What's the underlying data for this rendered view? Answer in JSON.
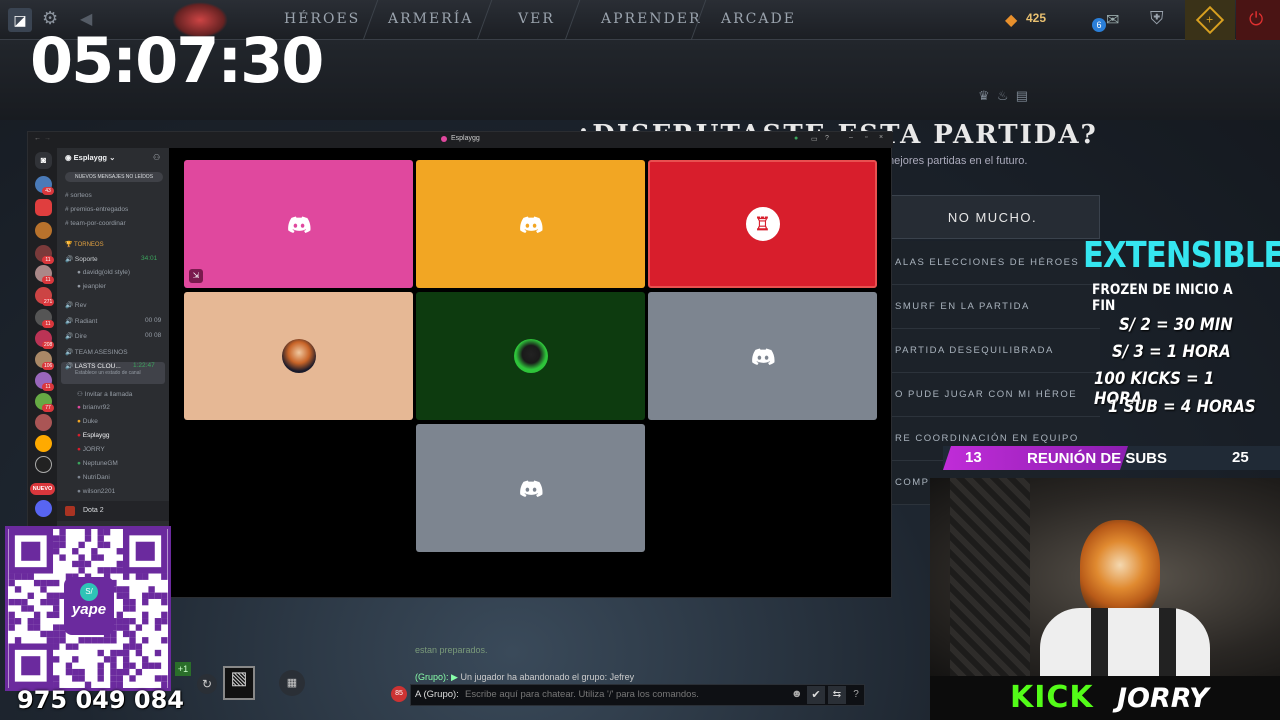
{
  "timer": "05:07:30",
  "topbar": {
    "nav": [
      "HÉROES",
      "ARMERÍA",
      "VER",
      "APRENDER",
      "ARCADE"
    ],
    "currency": "425",
    "notif_count": "6"
  },
  "survey": {
    "title": "¿DISFRUTASTE ESTA PARTIDA?",
    "subtitle": "mejores partidas en el futuro.",
    "options": [
      "NO MUCHO.",
      "ALAS ELECCIONES DE HÉROES",
      "SMURF EN LA PARTIDA",
      "PARTIDA DESEQUILIBRADA",
      "O PUDE JUGAR CON MI HÉROE",
      "RE COORDINACIÓN EN EQUIPO",
      "COMPO"
    ]
  },
  "discord": {
    "window_title": "Esplaygg",
    "server_name": "Esplaygg",
    "new_messages": "NUEVOS MENSAJES NO LEÍDOS",
    "channels": [
      "sorteos",
      "premios-entregados",
      "team-por-coordinar"
    ],
    "category_torneos": "TORNEOS",
    "voice": [
      {
        "name": "Soporte",
        "count": "34:01"
      },
      {
        "name": "davidg(old style)"
      },
      {
        "name": "jeanpler"
      },
      {
        "name": "Rev"
      },
      {
        "name": "Radiant",
        "count": "00 09"
      },
      {
        "name": "Dire",
        "count": "00 08"
      },
      {
        "name": "TEAM ASESINOS"
      },
      {
        "name": "LASTS CLOU...",
        "count": "1:22:47"
      },
      {
        "name": "Establece un estado de canal"
      },
      {
        "name": "Invitar a llamada"
      },
      {
        "name": "brianvr92"
      },
      {
        "name": "Duke"
      },
      {
        "name": "Esplaygg"
      },
      {
        "name": "JORRY"
      },
      {
        "name": "NeptuneGM"
      },
      {
        "name": "NutriDani"
      },
      {
        "name": "wilson2201"
      }
    ],
    "server_badges": [
      "43",
      "11",
      "11",
      "271",
      "11",
      "208",
      "106",
      "11",
      "77"
    ],
    "new_label": "NUEVO",
    "footer": "Dota 2",
    "tiles": [
      {
        "color": "#e0489e",
        "kind": "logo"
      },
      {
        "color": "#f2a623",
        "kind": "logo"
      },
      {
        "color": "#d81e2c",
        "kind": "avatar-red"
      },
      {
        "color": "#e6b895",
        "kind": "avatar-anime"
      },
      {
        "color": "#0d3b0f",
        "kind": "avatar-green"
      },
      {
        "color": "#7d8590",
        "kind": "logo"
      },
      {
        "color": "#7d8590",
        "kind": "logo"
      }
    ]
  },
  "promo": {
    "headline": "EXTENSIBLE",
    "sub": "FROZEN DE INICIO A FIN",
    "lines": [
      "S/ 2 = 30 MIN",
      "S/ 3  = 1 HORA",
      "100 KICKS = 1 HORA",
      "1 SUB = 4 HORAS"
    ]
  },
  "subs_bar": {
    "left": "13",
    "label": "REUNIÓN DE SUBS",
    "right": "25"
  },
  "qr": {
    "brand": "yape",
    "phone": "975 049 084"
  },
  "chat": {
    "line1": "estan preparados.",
    "line2_prefix": "(Grupo):",
    "line2": "Un jugador ha abandonado el grupo: Jefrey",
    "input_prefix": "A (Grupo):",
    "placeholder": "Escribe aquí para chatear. Utiliza '/' para los comandos.",
    "level": "85",
    "plus": "+1"
  },
  "kick": {
    "brand": "KICK",
    "user": "JORRY"
  },
  "colors": {
    "discord_blurple": "#5865f2",
    "kick_green": "#53fc18",
    "promo_cyan": "#35e6f0",
    "subs_magenta": "#b52bd6"
  }
}
